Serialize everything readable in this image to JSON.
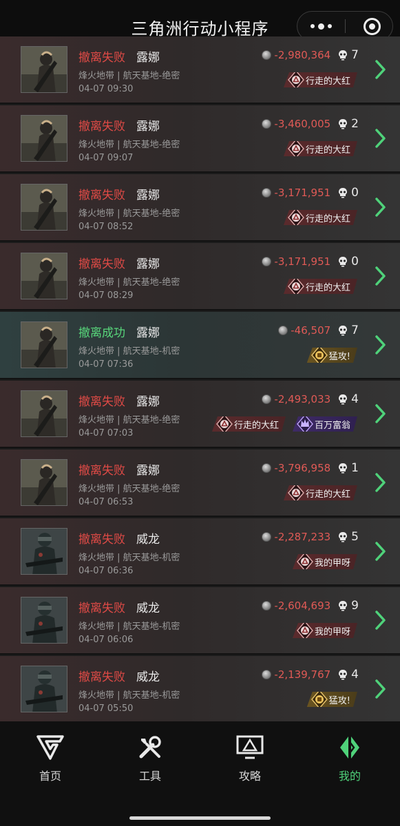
{
  "app": {
    "title": "三角洲行动小程序"
  },
  "records": [
    {
      "status": "撤离失败",
      "success": false,
      "operator": "露娜",
      "map": "烽火地带 | 航天基地-绝密",
      "time": "04-07 09:30",
      "value": "-2,980,364",
      "kills": "7",
      "tags": [
        {
          "label": "行走的大红",
          "style": "red",
          "icon": "triangle-badge-icon"
        }
      ]
    },
    {
      "status": "撤离失败",
      "success": false,
      "operator": "露娜",
      "map": "烽火地带 | 航天基地-绝密",
      "time": "04-07 09:07",
      "value": "-3,460,005",
      "kills": "2",
      "tags": [
        {
          "label": "行走的大红",
          "style": "red",
          "icon": "triangle-badge-icon"
        }
      ]
    },
    {
      "status": "撤离失败",
      "success": false,
      "operator": "露娜",
      "map": "烽火地带 | 航天基地-绝密",
      "time": "04-07 08:52",
      "value": "-3,171,951",
      "kills": "0",
      "tags": [
        {
          "label": "行走的大红",
          "style": "red",
          "icon": "triangle-badge-icon"
        }
      ]
    },
    {
      "status": "撤离失败",
      "success": false,
      "operator": "露娜",
      "map": "烽火地带 | 航天基地-绝密",
      "time": "04-07 08:29",
      "value": "-3,171,951",
      "kills": "0",
      "tags": [
        {
          "label": "行走的大红",
          "style": "red",
          "icon": "triangle-badge-icon"
        }
      ]
    },
    {
      "status": "撤离成功",
      "success": true,
      "operator": "露娜",
      "map": "烽火地带 | 航天基地-机密",
      "time": "04-07 07:36",
      "value": "-46,507",
      "kills": "7",
      "tags": [
        {
          "label": "猛攻!",
          "style": "gold",
          "icon": "fist-badge-icon"
        }
      ]
    },
    {
      "status": "撤离失败",
      "success": false,
      "operator": "露娜",
      "map": "烽火地带 | 航天基地-绝密",
      "time": "04-07 07:03",
      "value": "-2,493,033",
      "kills": "4",
      "tags": [
        {
          "label": "行走的大红",
          "style": "red",
          "icon": "triangle-badge-icon"
        },
        {
          "label": "百万富翁",
          "style": "purple",
          "icon": "crown-badge-icon"
        }
      ]
    },
    {
      "status": "撤离失败",
      "success": false,
      "operator": "露娜",
      "map": "烽火地带 | 航天基地-绝密",
      "time": "04-07 06:53",
      "value": "-3,796,958",
      "kills": "1",
      "tags": [
        {
          "label": "行走的大红",
          "style": "red",
          "icon": "triangle-badge-icon"
        }
      ]
    },
    {
      "status": "撤离失败",
      "success": false,
      "operator": "威龙",
      "map": "烽火地带 | 航天基地-机密",
      "time": "04-07 06:36",
      "value": "-2,287,233",
      "kills": "5",
      "tags": [
        {
          "label": "我的甲呀",
          "style": "red",
          "icon": "triangle-badge-icon"
        }
      ]
    },
    {
      "status": "撤离失败",
      "success": false,
      "operator": "威龙",
      "map": "烽火地带 | 航天基地-机密",
      "time": "04-07 06:06",
      "value": "-2,604,693",
      "kills": "9",
      "tags": [
        {
          "label": "我的甲呀",
          "style": "red",
          "icon": "triangle-badge-icon"
        }
      ]
    },
    {
      "status": "撤离失败",
      "success": false,
      "operator": "威龙",
      "map": "烽火地带 | 航天基地-机密",
      "time": "04-07 05:50",
      "value": "-2,139,767",
      "kills": "4",
      "tags": [
        {
          "label": "猛攻!",
          "style": "gold",
          "icon": "fist-badge-icon"
        }
      ]
    }
  ],
  "nav": {
    "items": [
      {
        "label": "首页",
        "icon": "g-logo-icon",
        "active": false
      },
      {
        "label": "工具",
        "icon": "wrench-screwdriver-icon",
        "active": false
      },
      {
        "label": "攻略",
        "icon": "monitor-icon",
        "active": false
      },
      {
        "label": "我的",
        "icon": "diamond-split-icon",
        "active": true
      }
    ]
  },
  "colors": {
    "fail": "#e04a46",
    "success": "#58d67b",
    "value": "#e05a56",
    "accent": "#4fd27a"
  }
}
